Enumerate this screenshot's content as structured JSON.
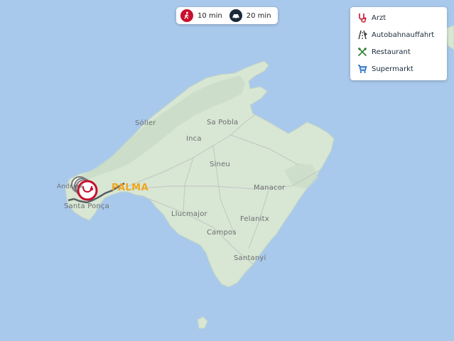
{
  "travel": {
    "walk_label": "10 min",
    "drive_label": "20 min",
    "walk_color": "#c8102e",
    "drive_color": "#1a2a3a"
  },
  "legend": {
    "items": [
      {
        "label": "Arzt",
        "icon": "stethoscope-icon",
        "color": "#c8102e"
      },
      {
        "label": "Autobahnauffahrt",
        "icon": "highway-icon",
        "color": "#333333"
      },
      {
        "label": "Restaurant",
        "icon": "cutlery-icon",
        "color": "#2e7d32"
      },
      {
        "label": "Supermarkt",
        "icon": "cart-icon",
        "color": "#1565c0"
      }
    ]
  },
  "map": {
    "sea_color": "#a9c9ec",
    "land_color": "#d8e6d4",
    "city_label": "PALMA",
    "places": {
      "soller": "Sóller",
      "sa_pobla": "Sa Pobla",
      "inca": "Inca",
      "sineu": "Sineu",
      "manacor": "Manacor",
      "llucmajor": "Llucmajor",
      "felanitx": "Felanitx",
      "campos": "Campos",
      "santanyi": "Santanyí",
      "santa_ponca": "Santa Ponça",
      "andratx": "Andratx"
    }
  }
}
